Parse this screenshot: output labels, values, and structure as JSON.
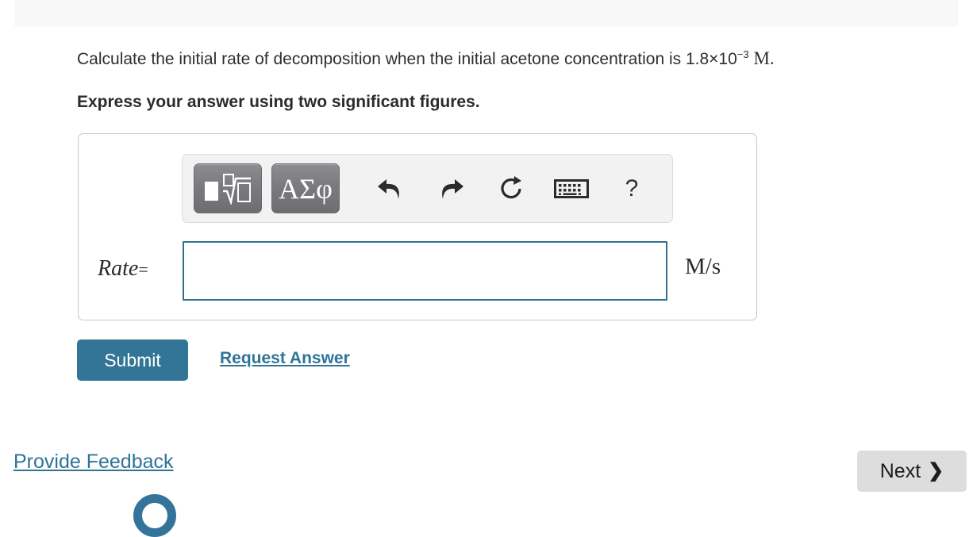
{
  "question": {
    "text_before": "Calculate the initial rate of decomposition when the initial acetone concentration is ",
    "value_mantissa": "1.8×10",
    "value_exponent": "−3",
    "value_unit": "M",
    "text_after": "."
  },
  "instruction": "Express your answer using two significant figures.",
  "toolbar": {
    "template_button": "square-root-template",
    "greek_button": "ΑΣφ",
    "undo": "undo-icon",
    "redo": "redo-icon",
    "reset": "reset-icon",
    "keyboard": "keyboard-icon",
    "help": "?"
  },
  "answer": {
    "label": "Rate",
    "equals": "=",
    "value": "",
    "placeholder": "",
    "units": "M/s"
  },
  "actions": {
    "submit": "Submit",
    "request_answer": "Request Answer"
  },
  "footer": {
    "provide_feedback": "Provide Feedback",
    "next": "Next",
    "next_chevron": "❯"
  },
  "colors": {
    "accent_blue": "#337596",
    "link_blue": "#2f7496",
    "input_border": "#33708f",
    "next_bg": "#dddddd",
    "panel_border": "#c9c9c9",
    "toolbar_bg": "#f2f2f2"
  }
}
